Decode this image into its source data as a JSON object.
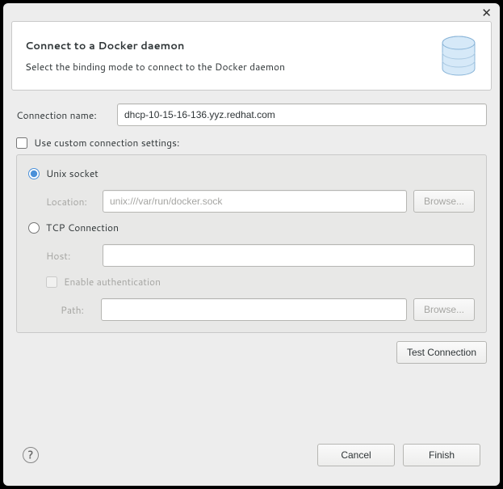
{
  "header": {
    "title": "Connect to a Docker daemon",
    "subtitle": "Select the binding mode to connect to the Docker daemon"
  },
  "form": {
    "connection_name_label": "Connection name:",
    "connection_name_value": "dhcp-10-15-16-136.yyz.redhat.com",
    "use_custom_label": "Use custom connection settings:",
    "unix_socket_label": "Unix socket",
    "location_label": "Location:",
    "location_value": "unix:///var/run/docker.sock",
    "browse_label": "Browse...",
    "tcp_label": "TCP Connection",
    "host_label": "Host:",
    "host_value": "",
    "enable_auth_label": "Enable authentication",
    "path_label": "Path:",
    "path_value": "",
    "test_connection_label": "Test Connection"
  },
  "footer": {
    "cancel_label": "Cancel",
    "finish_label": "Finish"
  }
}
